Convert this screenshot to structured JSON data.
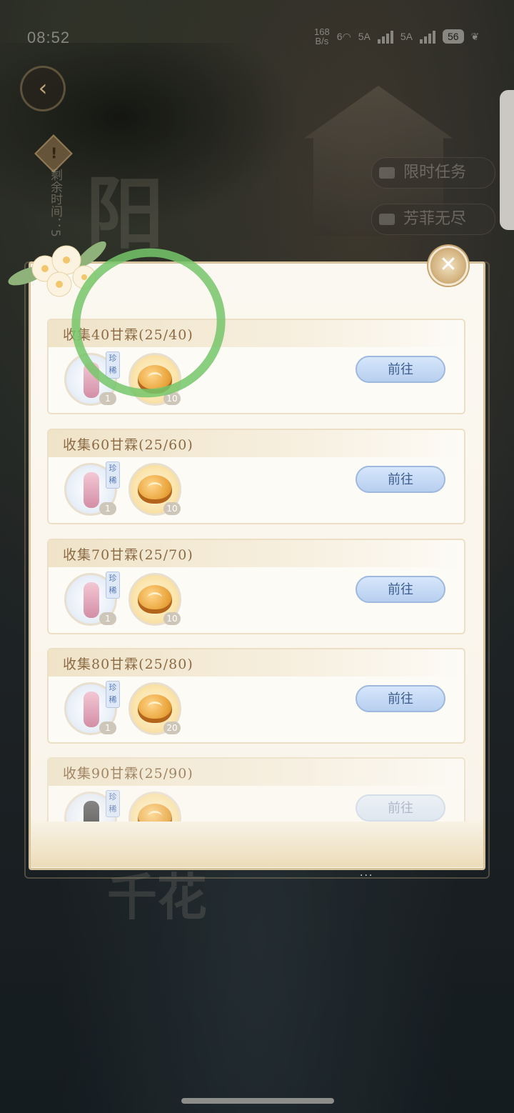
{
  "status_bar": {
    "time": "08:52",
    "net_speed_value": "168",
    "net_speed_unit": "B/s",
    "wifi_label": "6",
    "sim1_label": "5A",
    "sim2_label": "5A",
    "battery": "56"
  },
  "background": {
    "remaining_time_label": "剩余时间：5",
    "deco_title": "阳",
    "deco_bottom": "千花",
    "side_buttons": [
      {
        "label": "限时任务"
      },
      {
        "label": "芳菲无尽"
      }
    ]
  },
  "panel": {
    "cards": [
      {
        "title": "收集40甘霖(25/40)",
        "rare_label": "珍稀",
        "item_qty": "1",
        "coin_qty": "10",
        "button": "前往"
      },
      {
        "title": "收集60甘霖(25/60)",
        "rare_label": "珍稀",
        "item_qty": "1",
        "coin_qty": "10",
        "button": "前往"
      },
      {
        "title": "收集70甘霖(25/70)",
        "rare_label": "珍稀",
        "item_qty": "1",
        "coin_qty": "10",
        "button": "前往"
      },
      {
        "title": "收集80甘霖(25/80)",
        "rare_label": "珍稀",
        "item_qty": "1",
        "coin_qty": "20",
        "button": "前往"
      },
      {
        "title": "收集90甘霖(25/90)",
        "rare_label": "珍稀",
        "item_qty": "",
        "coin_qty": "",
        "button": "前往"
      }
    ]
  },
  "colors": {
    "accent_blue": "#b7cfef",
    "title_brown": "#8b6a44",
    "annotation_green": "#76c66a"
  },
  "icons": [
    "back-arrow-icon",
    "notice-icon",
    "close-icon",
    "wifi-icon",
    "signal-icon",
    "battery-icon",
    "leaf-icon"
  ]
}
